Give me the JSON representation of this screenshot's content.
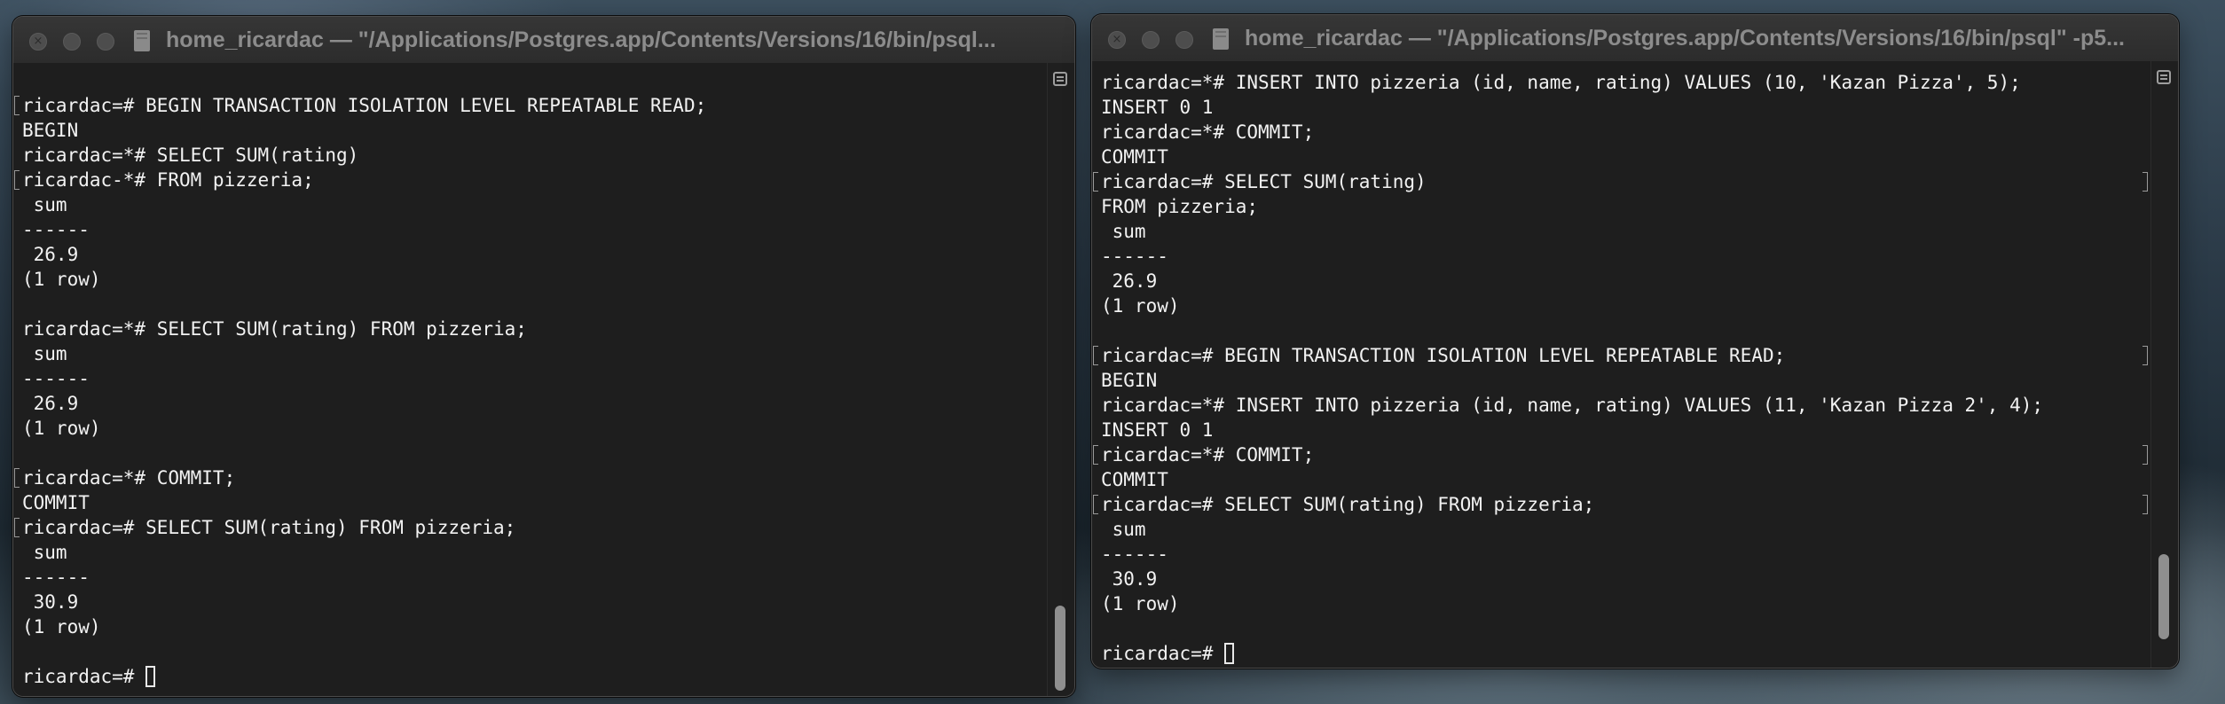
{
  "windows": [
    {
      "title": "home_ricardac — \"/Applications/Postgres.app/Contents/Versions/16/bin/psql...",
      "lines": [
        {
          "text": "",
          "mark": false
        },
        {
          "text": "ricardac=# BEGIN TRANSACTION ISOLATION LEVEL REPEATABLE READ;",
          "mark": true
        },
        {
          "text": "BEGIN",
          "mark": false
        },
        {
          "text": "ricardac=*# SELECT SUM(rating)",
          "mark": false
        },
        {
          "text": "ricardac-*# FROM pizzeria;",
          "mark": true
        },
        {
          "text": " sum",
          "mark": false
        },
        {
          "text": "------",
          "mark": false
        },
        {
          "text": " 26.9",
          "mark": false
        },
        {
          "text": "(1 row)",
          "mark": false
        },
        {
          "text": "",
          "mark": false
        },
        {
          "text": "ricardac=*# SELECT SUM(rating) FROM pizzeria;",
          "mark": false
        },
        {
          "text": " sum",
          "mark": false
        },
        {
          "text": "------",
          "mark": false
        },
        {
          "text": " 26.9",
          "mark": false
        },
        {
          "text": "(1 row)",
          "mark": false
        },
        {
          "text": "",
          "mark": false
        },
        {
          "text": "ricardac=*# COMMIT;",
          "mark": true
        },
        {
          "text": "COMMIT",
          "mark": false
        },
        {
          "text": "ricardac=# SELECT SUM(rating) FROM pizzeria;",
          "mark": true
        },
        {
          "text": " sum",
          "mark": false
        },
        {
          "text": "------",
          "mark": false
        },
        {
          "text": " 30.9",
          "mark": false
        },
        {
          "text": "(1 row)",
          "mark": false
        },
        {
          "text": "",
          "mark": false
        },
        {
          "text": "ricardac=# ",
          "mark": false,
          "cursor": true
        }
      ]
    },
    {
      "title": "home_ricardac — \"/Applications/Postgres.app/Contents/Versions/16/bin/psql\" -p5...",
      "lines": [
        {
          "text": "ricardac=*# INSERT INTO pizzeria (id, name, rating) VALUES (10, 'Kazan Pizza', 5);",
          "mark": false
        },
        {
          "text": "INSERT 0 1",
          "mark": false
        },
        {
          "text": "ricardac=*# COMMIT;",
          "mark": false
        },
        {
          "text": "COMMIT",
          "mark": false
        },
        {
          "text": "ricardac=# SELECT SUM(rating)",
          "mark": true
        },
        {
          "text": "FROM pizzeria;",
          "mark": false
        },
        {
          "text": " sum",
          "mark": false
        },
        {
          "text": "------",
          "mark": false
        },
        {
          "text": " 26.9",
          "mark": false
        },
        {
          "text": "(1 row)",
          "mark": false
        },
        {
          "text": "",
          "mark": false
        },
        {
          "text": "ricardac=# BEGIN TRANSACTION ISOLATION LEVEL REPEATABLE READ;",
          "mark": true
        },
        {
          "text": "BEGIN",
          "mark": false
        },
        {
          "text": "ricardac=*# INSERT INTO pizzeria (id, name, rating) VALUES (11, 'Kazan Pizza 2', 4);",
          "mark": false
        },
        {
          "text": "INSERT 0 1",
          "mark": false
        },
        {
          "text": "ricardac=*# COMMIT;",
          "mark": true
        },
        {
          "text": "COMMIT",
          "mark": false
        },
        {
          "text": "ricardac=# SELECT SUM(rating) FROM pizzeria;",
          "mark": true
        },
        {
          "text": " sum",
          "mark": false
        },
        {
          "text": "------",
          "mark": false
        },
        {
          "text": " 30.9",
          "mark": false
        },
        {
          "text": "(1 row)",
          "mark": false
        },
        {
          "text": "",
          "mark": false
        },
        {
          "text": "ricardac=# ",
          "mark": false,
          "cursor": true
        }
      ]
    }
  ],
  "colors": {
    "terminal_background": "#1e1e1e",
    "terminal_text": "#f2f2f2",
    "titlebar_text": "#8c8c8c"
  },
  "icons": {
    "close": "close-icon",
    "minimize": "minimize-icon",
    "zoom": "zoom-icon",
    "document": "document-icon",
    "scroll-menu": "scroll-menu-icon"
  }
}
